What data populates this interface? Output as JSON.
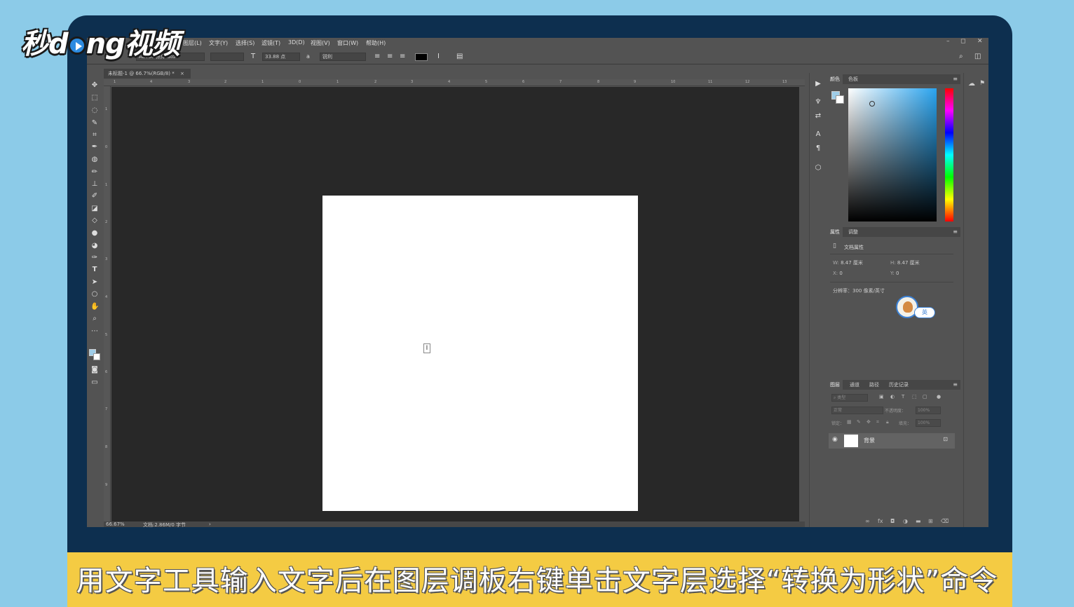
{
  "brand": {
    "logo_a": "秒d",
    "logo_b": "ng视频"
  },
  "caption": "用文字工具输入文字后在图层调板右键单击文字层选择“转换为形状”命令",
  "menubar": {
    "items": [
      "图层(L)",
      "文字(Y)",
      "选择(S)",
      "滤镜(T)",
      "3D(D)",
      "视图(V)",
      "窗口(W)",
      "帮助(H)"
    ],
    "minimize": "–",
    "restore": "◻",
    "close": "✕"
  },
  "options": {
    "font_family": "Adobe 黑体 Std",
    "font_size": "33.88 点",
    "antialias": "锐利",
    "text_color": "#000000"
  },
  "document": {
    "tab_title": "未标题-1 @ 66.7%(RGB/8) *",
    "tab_close": "×",
    "ruler_h_ticks": [
      "1",
      "4",
      "3",
      "2",
      "1",
      "0",
      "1",
      "2",
      "3",
      "4",
      "5",
      "6",
      "7",
      "8",
      "9",
      "10",
      "11",
      "12",
      "13"
    ],
    "ruler_v_ticks": [
      "1",
      "0",
      "1",
      "2",
      "3",
      "4",
      "5",
      "6",
      "7",
      "8",
      "9"
    ],
    "zoom": "66.67%",
    "doc_info": "文档:2.86M/0 字节",
    "status_arrow": "›"
  },
  "color_panel": {
    "tabs": [
      "颜色",
      "色板"
    ],
    "foreground": "#9fcde8",
    "background": "#ffffff"
  },
  "properties_panel": {
    "tabs": [
      "属性",
      "调整"
    ],
    "section_title": "文档属性",
    "w_label": "W:",
    "w_value": "8.47 厘米",
    "h_label": "H:",
    "h_value": "8.47 厘米",
    "x_label": "X:",
    "x_value": "0",
    "y_label": "Y:",
    "y_value": "0",
    "resolution": "分辨率：300 像素/英寸",
    "badge": "英"
  },
  "layers_panel": {
    "tabs": [
      "图层",
      "通道",
      "路径",
      "历史记录"
    ],
    "filter_placeholder": "类型",
    "blend_mode": "正常",
    "opacity_label": "不透明度：",
    "opacity_value": "100%",
    "lock_label": "锁定：",
    "fill_label": "填充：",
    "fill_value": "100%",
    "layer_name": "背景"
  }
}
